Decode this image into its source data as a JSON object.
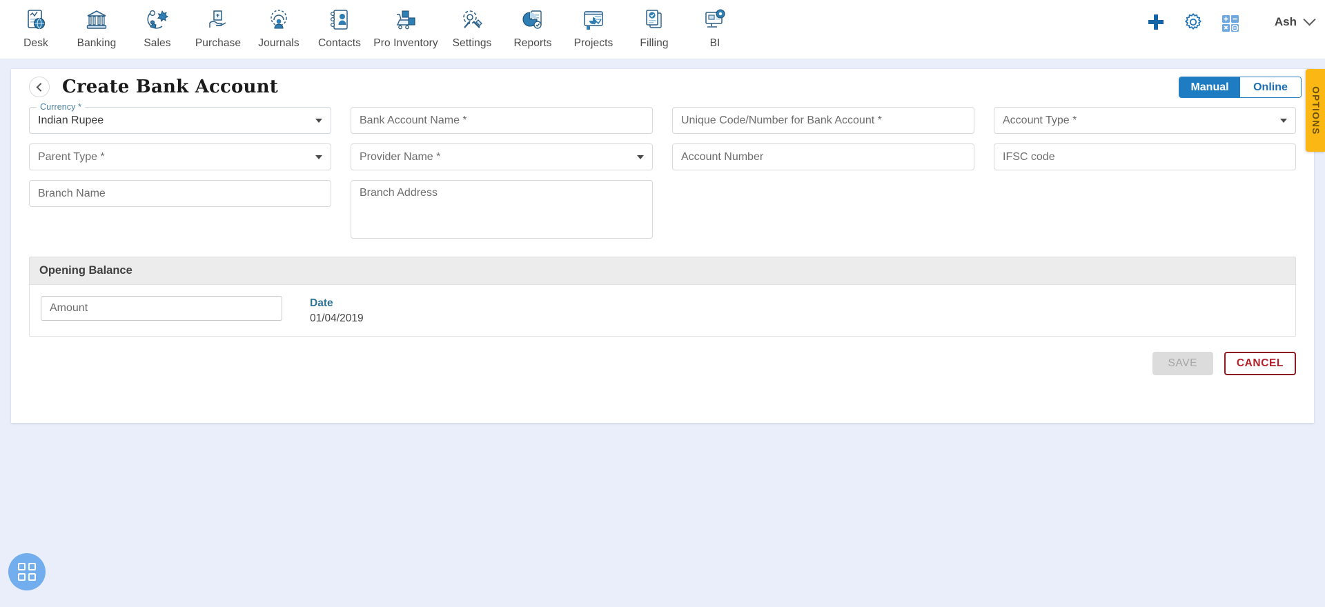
{
  "topnav": {
    "items": [
      {
        "label": "Desk",
        "icon": "dashboard-icon"
      },
      {
        "label": "Banking",
        "icon": "bank-icon"
      },
      {
        "label": "Sales",
        "icon": "sales-icon"
      },
      {
        "label": "Purchase",
        "icon": "purchase-icon"
      },
      {
        "label": "Journals",
        "icon": "journals-icon"
      },
      {
        "label": "Contacts",
        "icon": "contacts-icon"
      },
      {
        "label": "Pro Inventory",
        "icon": "inventory-icon"
      },
      {
        "label": "Settings",
        "icon": "settings-icon"
      },
      {
        "label": "Reports",
        "icon": "reports-icon"
      },
      {
        "label": "Projects",
        "icon": "projects-icon"
      },
      {
        "label": "Filling",
        "icon": "filling-icon"
      },
      {
        "label": "BI",
        "icon": "bi-icon"
      }
    ],
    "right": {
      "add_icon": "plus-icon",
      "settings_icon": "gear-icon",
      "calculator_icon": "calculator-icon",
      "user_name": "Ash",
      "user_chevron": "chevron-down-icon"
    }
  },
  "page": {
    "back_icon": "chevron-left-icon",
    "title": "Create Bank Account",
    "mode_toggle": {
      "manual": "Manual",
      "online": "Online",
      "active": "Manual"
    },
    "options_tab": "OPTIONS"
  },
  "form": {
    "currency": {
      "label": "Currency *",
      "value": "Indian Rupee",
      "caret": "chevron-down-icon"
    },
    "bank_account_name": {
      "placeholder": "Bank Account Name *",
      "value": ""
    },
    "unique_code": {
      "placeholder": "Unique Code/Number for Bank Account *",
      "value": ""
    },
    "account_type": {
      "placeholder": "Account Type *",
      "value": "",
      "caret": "chevron-down-icon"
    },
    "parent_type": {
      "placeholder": "Parent Type *",
      "value": "",
      "caret": "chevron-down-icon"
    },
    "provider_name": {
      "placeholder": "Provider Name *",
      "value": "",
      "caret": "chevron-down-icon"
    },
    "account_number": {
      "placeholder": "Account Number",
      "value": ""
    },
    "ifsc_code": {
      "placeholder": "IFSC code",
      "value": ""
    },
    "branch_name": {
      "placeholder": "Branch Name",
      "value": ""
    },
    "branch_address": {
      "placeholder": "Branch Address",
      "value": ""
    }
  },
  "opening_balance": {
    "section_title": "Opening Balance",
    "amount": {
      "placeholder": "Amount",
      "value": ""
    },
    "date_label": "Date",
    "date_value": "01/04/2019"
  },
  "actions": {
    "save_label": "SAVE",
    "save_disabled": true,
    "cancel_label": "CANCEL"
  },
  "fab": {
    "icon": "grid-apps-icon"
  },
  "colors": {
    "page_background": "#e9eefa",
    "accent_blue": "#1d7cc2",
    "options_amber": "#fbb713",
    "cancel_red": "#b31f29",
    "date_label_teal": "#2e7496",
    "fab_blue": "#72aeee"
  }
}
